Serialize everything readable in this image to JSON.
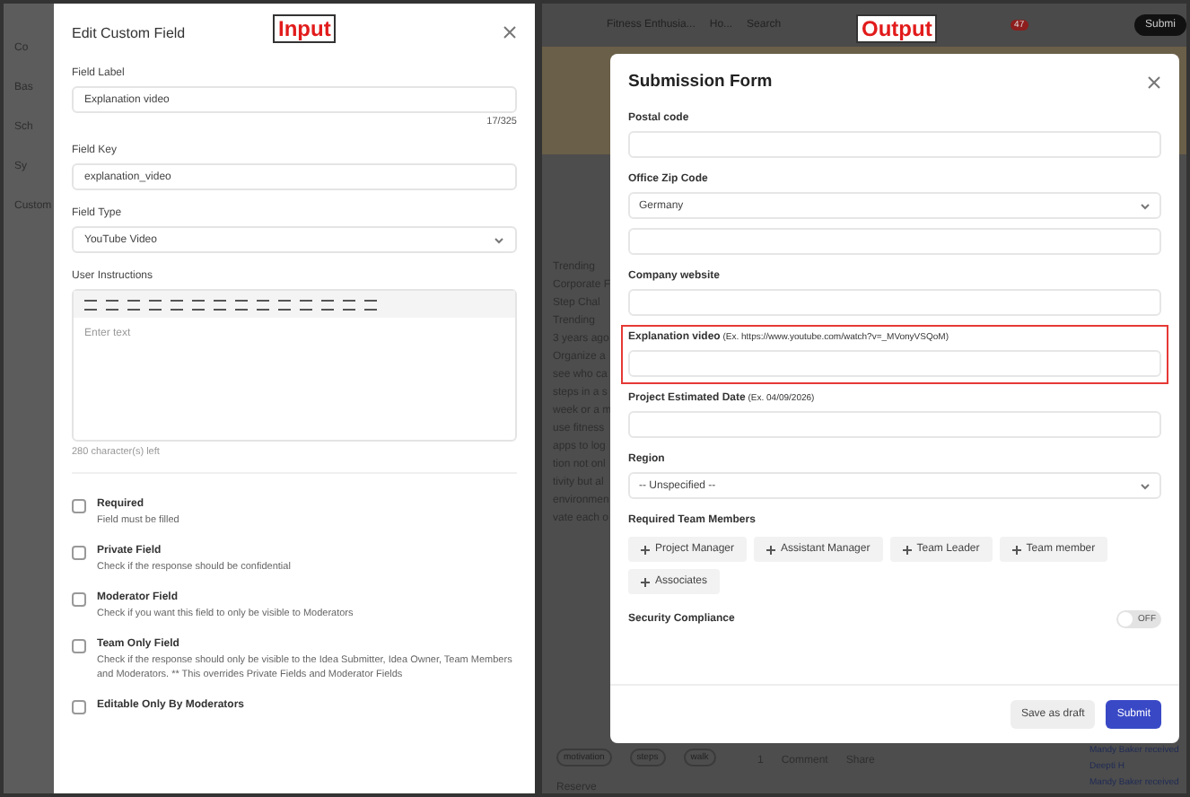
{
  "annotations": [
    {
      "text": "Input"
    },
    {
      "text": "Output"
    }
  ],
  "left_background": {
    "items": [
      "Co",
      "Bas",
      "Sch",
      "Sy",
      "Custom"
    ]
  },
  "edit_panel": {
    "title": "Edit Custom Field",
    "fields": [
      {
        "label": "Field Label",
        "value": "Explanation video",
        "counter": "17/325"
      },
      {
        "label": "Field Key",
        "value": "explanation_video"
      }
    ],
    "field_type": {
      "label": "Field Type",
      "value": "YouTube Video"
    },
    "instructions": {
      "label": "User Instructions",
      "placeholder": "Enter text",
      "chars_left": "280 character(s) left"
    },
    "options": [
      {
        "title": "Required",
        "description": "Field must be filled",
        "checked": false
      },
      {
        "title": "Private Field",
        "description": "Check if the response should be confidential",
        "checked": false
      },
      {
        "title": "Moderator Field",
        "description": "Check if you want this field to only be visible to Moderators",
        "checked": false
      },
      {
        "title": "Team Only Field",
        "description": "Check if the response should only be visible to the Idea Submitter, Idea Owner, Team Members and Moderators. ** This overrides Private Fields and Moderator Fields",
        "checked": false
      },
      {
        "title": "Editable Only By Moderators",
        "checked": false
      }
    ]
  },
  "right_background": {
    "breadcrumb": [
      "Fitness Enthusia...",
      "Ho..."
    ],
    "search_placeholder": "Search",
    "notification_count": "47",
    "submit_label": "Submi",
    "tab": "Trending",
    "category": "Corporate F",
    "post_title": "Step Chal",
    "badge": "Trending",
    "time": "3 years ago",
    "body_lines": [
      "Organize a",
      "see who ca",
      "steps in a s",
      "week or a m",
      "use fitness",
      "apps to log",
      "tion not onl",
      "tivity but al",
      "environmen",
      "vate each o"
    ],
    "tags": [
      "motivation",
      "steps",
      "walk"
    ],
    "actions": [
      "Comment",
      "Share"
    ],
    "comment_count": "1",
    "section": "Reserve",
    "activity": [
      {
        "name": "Mandy Baker",
        "text": "received",
        "target": "Deepti H"
      },
      {
        "name": "Mandy Baker",
        "text": "received"
      }
    ]
  },
  "modal": {
    "title": "Submission Form",
    "fields": [
      {
        "kind": "text",
        "label": "Postal code"
      },
      {
        "kind": "select",
        "label": "Office Zip Code",
        "value": "Germany",
        "extra_input": true
      },
      {
        "kind": "text",
        "label": "Company website"
      },
      {
        "kind": "text",
        "label": "Explanation video",
        "hint": "(Ex. https://www.youtube.com/watch?v=_MVonyVSQoM)",
        "highlighted": true
      },
      {
        "kind": "text",
        "label": "Project Estimated Date",
        "hint": "(Ex. 04/09/2026)"
      },
      {
        "kind": "select",
        "label": "Region",
        "value": "-- Unspecified --"
      },
      {
        "kind": "chips",
        "label": "Required Team Members",
        "options": [
          "Project Manager",
          "Assistant Manager",
          "Team Leader",
          "Team member",
          "Associates"
        ]
      },
      {
        "kind": "toggle",
        "label": "Security Compliance",
        "on": false,
        "toggle_label": "OFF"
      }
    ],
    "buttons": [
      {
        "label": "Save as draft",
        "primary": false
      },
      {
        "label": "Submit",
        "primary": true
      }
    ]
  }
}
